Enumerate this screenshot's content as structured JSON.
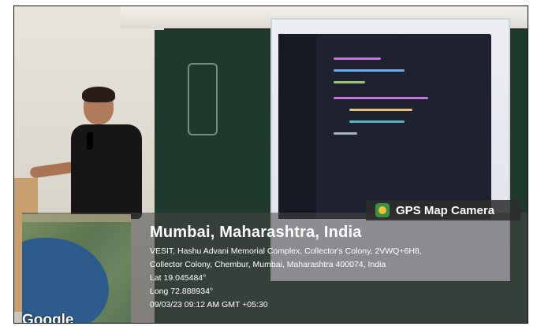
{
  "badge": {
    "icon": "gps-map-camera-icon",
    "label": "GPS Map Camera"
  },
  "location": {
    "title": "Mumbai, Maharashtra, India",
    "address_line1": "VESIT, Hashu Advani Memorial Complex, Collector's Colony, 2VWQ+6H8,",
    "address_line2": "Collector Colony, Chembur, Mumbai, Maharashtra 400074, India",
    "lat": "Lat 19.045484°",
    "long": "Long 72.888934°",
    "datetime": "09/03/23 09:12 AM GMT +05:30"
  },
  "map": {
    "provider_logo": "Google"
  },
  "colors": {
    "overlay": "#464646",
    "text": "#ffffff",
    "badge_icon": "#3b8f43"
  }
}
